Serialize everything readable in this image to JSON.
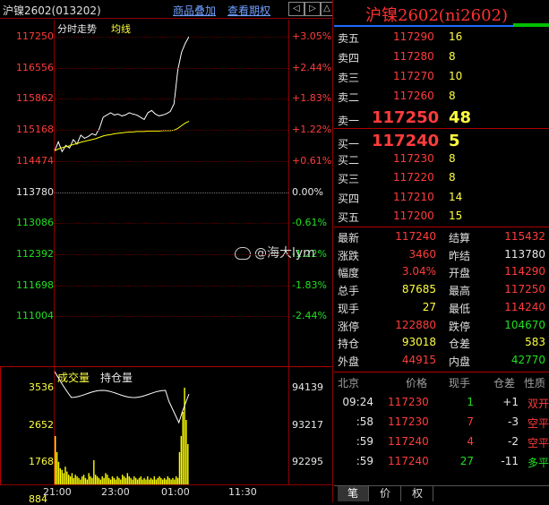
{
  "header": {
    "title": "沪镍2602(013202)",
    "link1": "商品叠加",
    "link2": "查看期权",
    "nav_icons": [
      "nav-left-icon",
      "nav-right-icon",
      "nav-up-icon",
      "nav-down-icon"
    ]
  },
  "chart": {
    "label_timeshare": "分时走势",
    "label_avg": "均线",
    "price_ticks": [
      "117250",
      "116556",
      "115862",
      "115168",
      "114474",
      "113780",
      "113086",
      "112392",
      "111698",
      "111004"
    ],
    "pct_ticks": [
      "+3.05%",
      "+2.44%",
      "+1.83%",
      "+1.22%",
      "+0.61%",
      "0.00%",
      "-0.61%",
      "-1.22%",
      "-1.83%",
      "-2.44%"
    ],
    "volume_label": "成交量",
    "oi_label": "持仓量",
    "volume_ticks": [
      "3536",
      "2652",
      "1768",
      "884"
    ],
    "oi_ticks": [
      "94139",
      "93217",
      "92295"
    ],
    "time_ticks": [
      "21:00",
      "23:00",
      "01:00",
      "11:30"
    ],
    "watermark": "@海大lym"
  },
  "chart_data": {
    "type": "line",
    "series": [
      {
        "name": "分时走势",
        "values": [
          114700,
          114900,
          114680,
          114820,
          114760,
          114950,
          114850,
          115050,
          114980,
          115020,
          115080,
          115050,
          115200,
          115450,
          115500,
          115550,
          115500,
          115520,
          115480,
          115500,
          115550,
          115520,
          115500,
          115450,
          115400,
          115550,
          115600,
          115520,
          115480,
          115500,
          115530,
          115580,
          115750,
          116500,
          116900,
          117100,
          117250
        ]
      },
      {
        "name": "均线",
        "values": [
          114700,
          114740,
          114770,
          114790,
          114810,
          114840,
          114860,
          114890,
          114910,
          114930,
          114950,
          114970,
          115000,
          115030,
          115050,
          115060,
          115080,
          115090,
          115100,
          115110,
          115120,
          115120,
          115130,
          115130,
          115130,
          115140,
          115140,
          115140,
          115140,
          115150,
          115150,
          115150,
          115160,
          115200,
          115260,
          115320,
          115360
        ]
      }
    ],
    "ylim": [
      111004,
      117250
    ],
    "xticks": [
      "21:00",
      "23:00",
      "01:00",
      "11:30"
    ]
  },
  "orderbook": {
    "title": "沪镍2602(ni2602)",
    "asks": [
      {
        "label": "卖五",
        "price": "117290",
        "qty": "16"
      },
      {
        "label": "卖四",
        "price": "117280",
        "qty": "8"
      },
      {
        "label": "卖三",
        "price": "117270",
        "qty": "10"
      },
      {
        "label": "卖二",
        "price": "117260",
        "qty": "8"
      },
      {
        "label": "卖一",
        "price": "117250",
        "qty": "48"
      }
    ],
    "bids": [
      {
        "label": "买一",
        "price": "117240",
        "qty": "5"
      },
      {
        "label": "买二",
        "price": "117230",
        "qty": "8"
      },
      {
        "label": "买三",
        "price": "117220",
        "qty": "8"
      },
      {
        "label": "买四",
        "price": "117210",
        "qty": "14"
      },
      {
        "label": "买五",
        "price": "117200",
        "qty": "15"
      }
    ]
  },
  "stats": [
    {
      "l1": "最新",
      "v1": "117240",
      "l2": "结算",
      "v2": "115432"
    },
    {
      "l1": "涨跌",
      "v1": "3460",
      "l2": "昨结",
      "v2": "113780"
    },
    {
      "l1": "幅度",
      "v1": "3.04%",
      "l2": "开盘",
      "v2": "114290"
    },
    {
      "l1": "总手",
      "v1": "87685",
      "l2": "最高",
      "v2": "117250"
    },
    {
      "l1": "现手",
      "v1": "27",
      "l2": "最低",
      "v2": "114240"
    },
    {
      "l1": "涨停",
      "v1": "122880",
      "l2": "跌停",
      "v2": "104670"
    },
    {
      "l1": "持仓",
      "v1": "93018",
      "l2": "仓差",
      "v2": "583"
    },
    {
      "l1": "外盘",
      "v1": "44915",
      "l2": "内盘",
      "v2": "42770"
    }
  ],
  "ticks_table": {
    "headers": [
      "北京",
      "价格",
      "现手",
      "仓差",
      "性质"
    ],
    "rows": [
      {
        "time": "09:24",
        "price": "117230",
        "qty": "1",
        "oi": "+1",
        "nature": "双开"
      },
      {
        "time": ":58",
        "price": "117230",
        "qty": "7",
        "oi": "-3",
        "nature": "空平"
      },
      {
        "time": ":59",
        "price": "117240",
        "qty": "4",
        "oi": "-2",
        "nature": "空平"
      },
      {
        "time": ":59",
        "price": "117240",
        "qty": "27",
        "oi": "-11",
        "nature": "多平"
      }
    ]
  },
  "tabs": [
    "笔",
    "价",
    "权"
  ]
}
